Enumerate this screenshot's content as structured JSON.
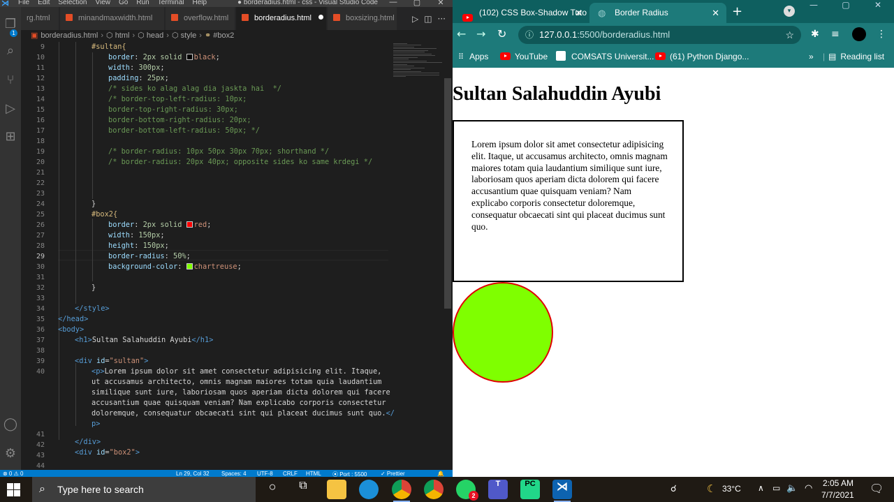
{
  "vscode": {
    "menu": [
      "File",
      "Edit",
      "Selection",
      "View",
      "Go",
      "Run",
      "Terminal",
      "Help"
    ],
    "window_title": "● borderadius.html - css - Visual Studio Code",
    "window_controls": [
      "—",
      "▢",
      "✕"
    ],
    "tabs": [
      {
        "label": "rg.html"
      },
      {
        "label": "minandmaxwidth.html"
      },
      {
        "label": "overflow.html"
      },
      {
        "label": "borderadius.html",
        "active": true
      },
      {
        "label": "boxsizing.html"
      }
    ],
    "tab_actions": [
      "▷",
      "◫",
      "···"
    ],
    "breadcrumb": [
      "borderadius.html",
      "html",
      "head",
      "style",
      "#box2"
    ],
    "activity_badge": "1",
    "line_numbers": [
      "9",
      "10",
      "11",
      "12",
      "13",
      "14",
      "15",
      "16",
      "17",
      "18",
      "19",
      "20",
      "21",
      "22",
      "23",
      "24",
      "25",
      "26",
      "27",
      "28",
      "29",
      "30",
      "31",
      "32",
      "33",
      "34",
      "35",
      "36",
      "37",
      "38",
      "39",
      "40",
      "",
      "",
      "",
      "",
      "",
      "41",
      "42",
      "43",
      "44"
    ],
    "current_line": "29",
    "code": {
      "l9": "#sultan{",
      "l10_prop": "border",
      "l10_val": "2px solid ",
      "l10_color": "black",
      "l11_prop": "width",
      "l11_val": "300px",
      "l12_prop": "padding",
      "l12_val": "25px",
      "l13": "/* sides ko alag alag dia jaskta hai  */",
      "l14": "/* border-top-left-radius: 10px;",
      "l15": "border-top-right-radius: 30px;",
      "l16": "border-bottom-right-radius: 20px;",
      "l17": "border-bottom-left-radius: 50px; */",
      "l19": "/* border-radius: 10px 50px 30px 70px; shorthand */",
      "l20": "/* border-radius: 20px 40px; opposite sides ko same krdegi */",
      "l24": "}",
      "l25": "#box2{",
      "l26_prop": "border",
      "l26_val": "2px solid ",
      "l26_color": "red",
      "l27_prop": "width",
      "l27_val": "150px",
      "l28_prop": "height",
      "l28_val": "150px",
      "l29_prop": "border-radius",
      "l29_val": "50%",
      "l30_prop": "background-color",
      "l30_color": "chartreuse",
      "l32": "}",
      "l34": "</style>",
      "l35": "</head>",
      "l36": "<body>",
      "l37_open": "<h1>",
      "l37_text": "Sultan Salahuddin Ayubi",
      "l37_close": "</h1>",
      "l39_tag": "<div ",
      "l39_attr": "id",
      "l39_val": "\"sultan\"",
      "l39_end": ">",
      "l40a": "Lorem ipsum dolor sit amet consectetur adipisicing elit. Itaque,",
      "l40b": "ut accusamus architecto, omnis magnam maiores totam quia laudantium",
      "l40c": "similique sunt iure, laboriosam quos aperiam dicta dolorem qui facere",
      "l40d": "accusantium quae quisquam veniam? Nam explicabo corporis consectetur",
      "l40e": "doloremque, consequatur obcaecati sint qui placeat ducimus sunt quo.",
      "l40f": "p>",
      "l42": "</div>",
      "l43_tag": "<div ",
      "l43_attr": "id",
      "l43_val": "\"box2\"",
      "l43_end": ">"
    },
    "status": {
      "problems": "⊗ 0 ⚠ 0",
      "position": "Ln 29, Col 32",
      "spaces": "Spaces: 4",
      "encoding": "UTF-8",
      "eol": "CRLF",
      "language": "HTML",
      "port": "⦿ Port : 5500",
      "prettier": "✓ Prettier"
    }
  },
  "chrome": {
    "tabs": [
      {
        "label": "(102) CSS Box-Shadow Tuto",
        "active": false
      },
      {
        "label": "Border Radius",
        "active": true
      }
    ],
    "new_tab": "+",
    "url_host": "127.0.0.1",
    "url_rest": ":5500/borderadius.html",
    "bookmarks": {
      "apps": "Apps",
      "youtube": "YouTube",
      "comsats": "COMSATS Universit...",
      "python": "(61) Python Django...",
      "more": "»",
      "reading_list": "Reading list"
    },
    "page": {
      "h1": "Sultan Salahuddin Ayubi",
      "paragraph": "Lorem ipsum dolor sit amet consectetur adipisicing elit. Itaque, ut accusamus architecto, omnis magnam maiores totam quia laudantium similique sunt iure, laboriosam quos aperiam dicta dolorem qui facere accusantium quae quisquam veniam? Nam explicabo corporis consectetur doloremque, consequatur obcaecati sint qui placeat ducimus sunt quo."
    },
    "colors": {
      "box2_bg": "#7fff00",
      "box2_border": "#e00000",
      "theme": "#1d7a7a"
    }
  },
  "taskbar": {
    "search_placeholder": "Type here to search",
    "weather": "33°C",
    "time": "2:05 AM",
    "date": "7/7/2021",
    "whatsapp_badge": "2"
  }
}
